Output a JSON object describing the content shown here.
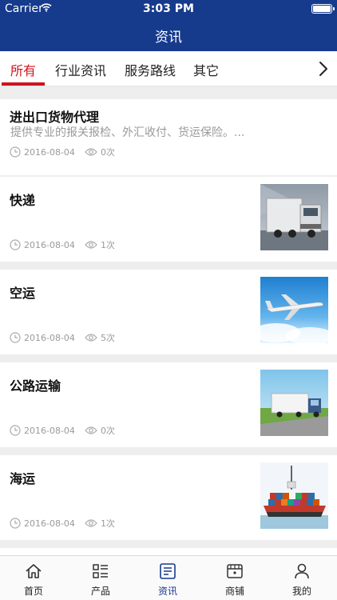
{
  "status": {
    "carrier": "Carrier",
    "time": "3:03 PM"
  },
  "nav": {
    "title": "资讯"
  },
  "tabs": [
    {
      "label": "所有",
      "active": true
    },
    {
      "label": "行业资讯",
      "active": false
    },
    {
      "label": "服务路线",
      "active": false
    },
    {
      "label": "其它",
      "active": false
    }
  ],
  "articles": [
    {
      "title": "进出口货物代理",
      "summary": "提供专业的报关报检、外汇收付、货运保险。...",
      "date": "2016-08-04",
      "views": "0次"
    },
    {
      "title": "快递",
      "date": "2016-08-04",
      "views": "1次",
      "image": "truck"
    },
    {
      "title": "空运",
      "date": "2016-08-04",
      "views": "5次",
      "image": "airplane"
    },
    {
      "title": "公路运输",
      "date": "2016-08-04",
      "views": "0次",
      "image": "truck-road"
    },
    {
      "title": "海运",
      "date": "2016-08-04",
      "views": "1次",
      "image": "container-ship"
    }
  ],
  "bottom_nav": [
    {
      "label": "首页",
      "icon": "home-icon",
      "active": false
    },
    {
      "label": "产品",
      "icon": "list-icon",
      "active": false
    },
    {
      "label": "资讯",
      "icon": "news-icon",
      "active": true
    },
    {
      "label": "商铺",
      "icon": "store-icon",
      "active": false
    },
    {
      "label": "我的",
      "icon": "user-icon",
      "active": false
    }
  ],
  "colors": {
    "brand": "#163a8c",
    "accent": "#d0121b",
    "muted": "#9a9a9a"
  }
}
